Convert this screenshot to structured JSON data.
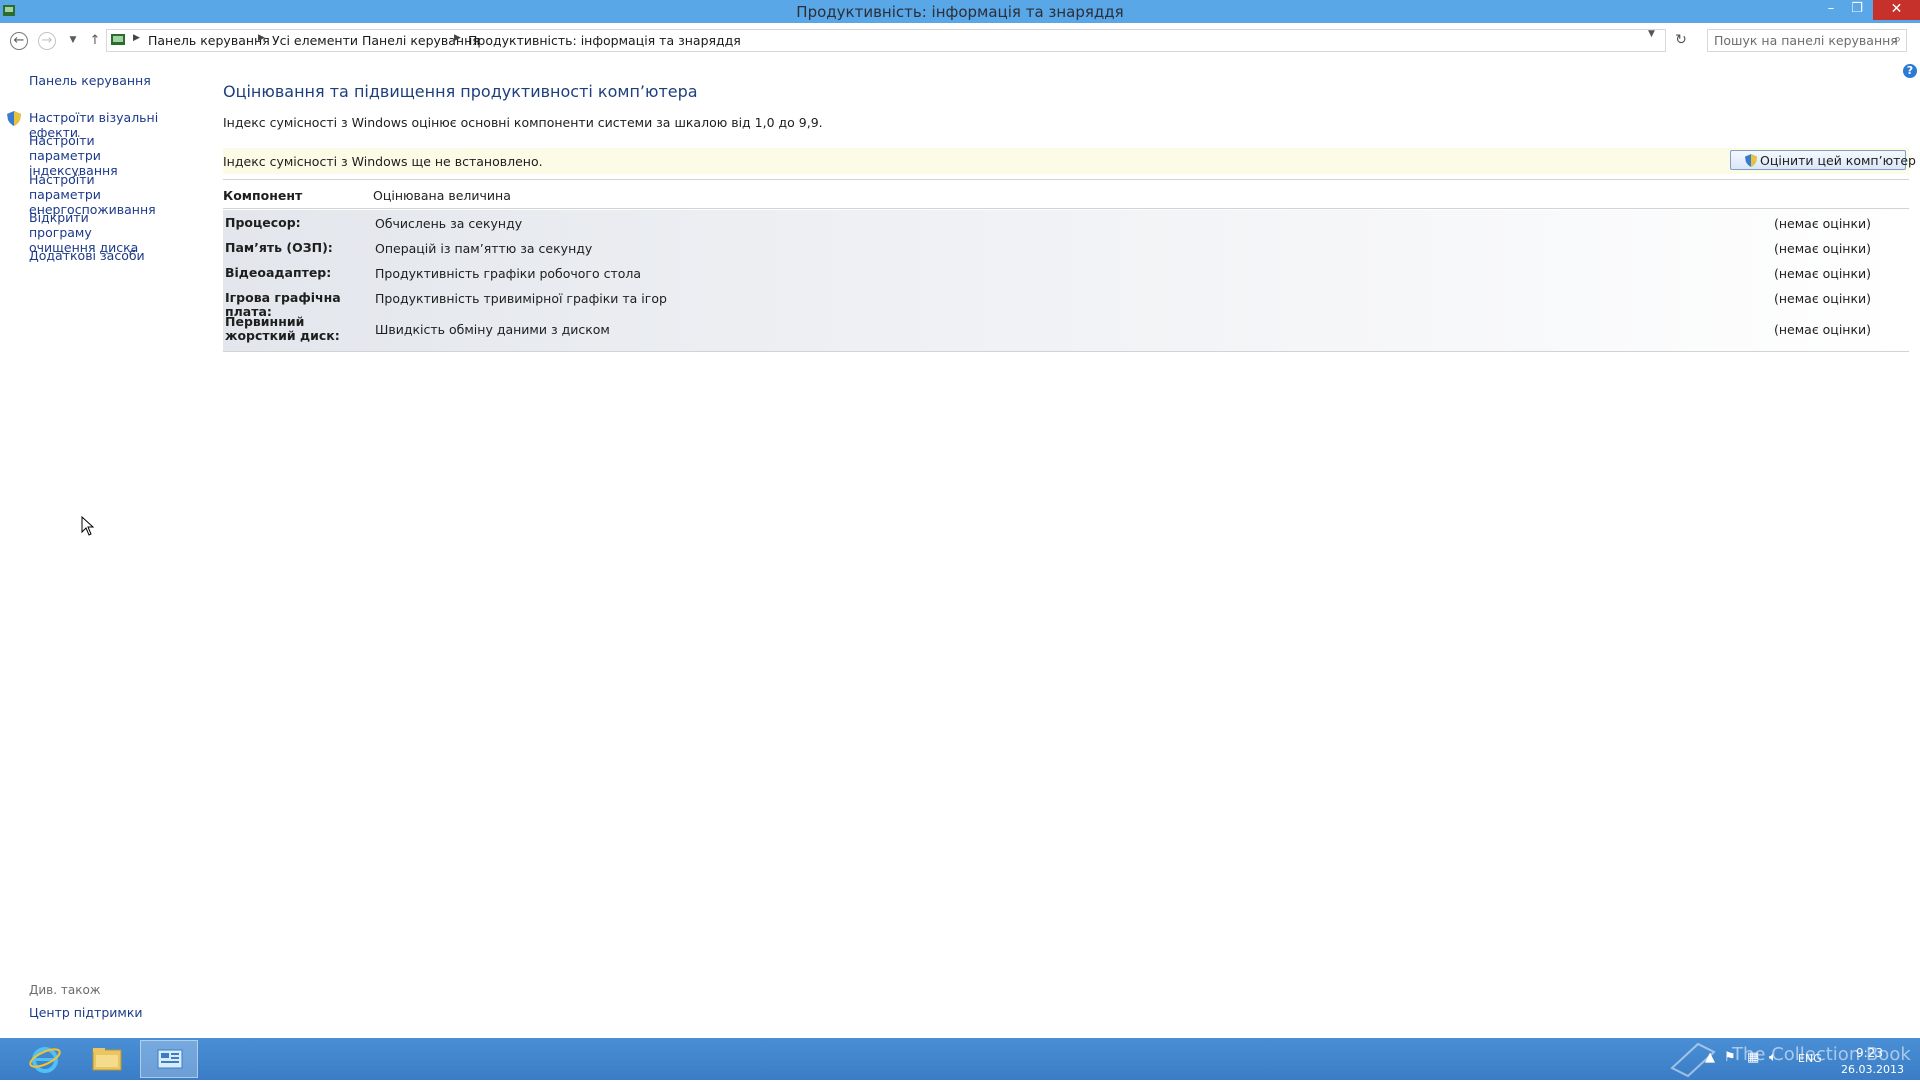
{
  "window": {
    "title": "Продуктивність: інформація та знаряддя",
    "buttons": {
      "minimize": "–",
      "restore": "❐",
      "close": "✕"
    }
  },
  "address_bar": {
    "breadcrumbs": [
      "Панель керування",
      "Усі елементи Панелі керування",
      "Продуктивність: інформація та знаряддя"
    ],
    "search_placeholder": "Пошук на панелі керування"
  },
  "left_pane": {
    "home_link": "Панель керування",
    "tasks": [
      "Настроїти візуальні ефекти",
      "Настроїти параметри індексування",
      "Настроїти параметри енергоспоживання",
      "Відкрити програму очищення диска",
      "Додаткові засоби"
    ],
    "see_also_label": "Див. також",
    "see_also_links": [
      "Центр підтримки"
    ]
  },
  "main": {
    "title": "Оцінювання та підвищення продуктивності комп’ютера",
    "description": "Індекс сумісності з Windows оцінює основні компоненти системи за шкалою від 1,0 до 9,9.",
    "notice": "Індекс сумісності з Windows ще не встановлено.",
    "rate_button": "Оцінити цей комп’ютер",
    "columns": [
      "Компонент",
      "Оцінювана величина"
    ],
    "rows": [
      {
        "component": "Процесор:",
        "measure": "Обчислень за секунду",
        "score": "(немає оцінки)"
      },
      {
        "component": "Пам’ять (ОЗП):",
        "measure": "Операцій із пам’яттю за секунду",
        "score": "(немає оцінки)"
      },
      {
        "component": "Відеоадаптер:",
        "measure": "Продуктивність графіки робочого стола",
        "score": "(немає оцінки)"
      },
      {
        "component": "Ігрова графічна плата:",
        "measure": "Продуктивність тривимірної графіки та ігор",
        "score": "(немає оцінки)"
      },
      {
        "component": "Первинний жорсткий диск:",
        "measure": "Швидкість обміну даними з диском",
        "score": "(немає оцінки)"
      }
    ]
  },
  "taskbar": {
    "language": "ENG",
    "time": "9:23",
    "date": "26.03.2013",
    "watermark": "The Collection Book"
  },
  "colors": {
    "titlebar": "#5aa7e8",
    "taskbar": "#3f85cf",
    "link": "#1c3a8a",
    "heading": "#1e3f7c",
    "notice_bg": "#fcfbe6",
    "close_button": "#c7312c"
  }
}
